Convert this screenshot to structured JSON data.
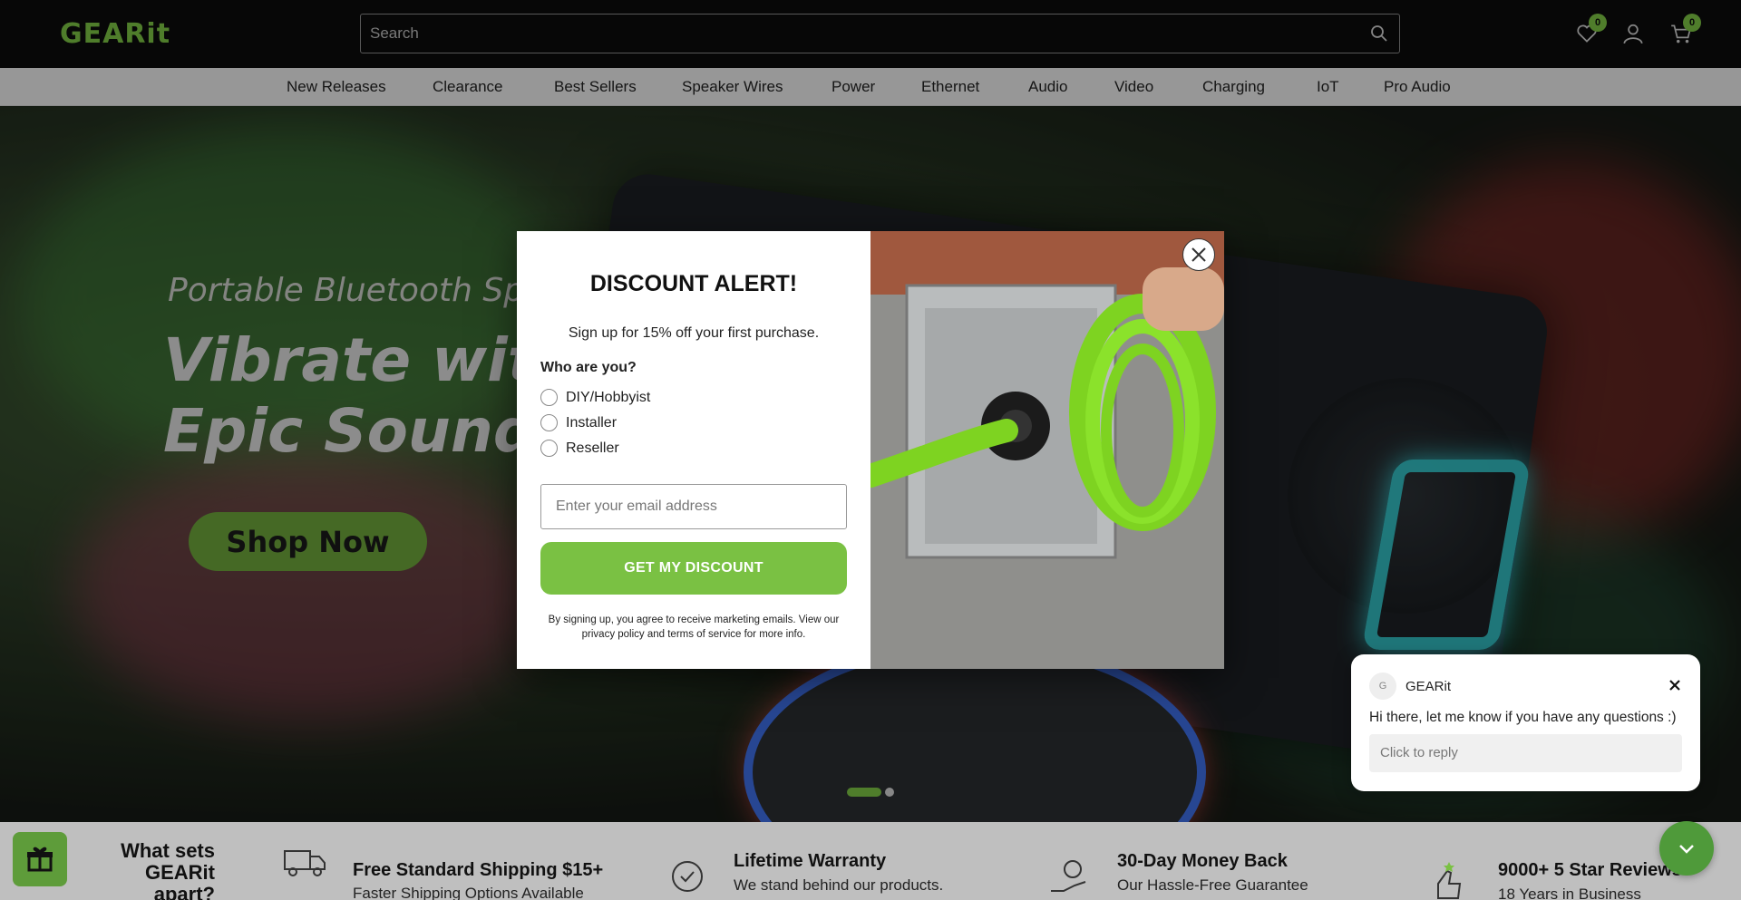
{
  "header": {
    "logo": "GEARit",
    "search_placeholder": "Search",
    "wishlist_count": "0",
    "cart_count": "0"
  },
  "nav": {
    "items": [
      "New Releases",
      "Clearance",
      "Best Sellers",
      "Speaker Wires",
      "Power",
      "Ethernet",
      "Audio",
      "Video",
      "Charging",
      "IoT",
      "Pro Audio"
    ]
  },
  "hero": {
    "subtitle": "Portable Bluetooth Spe",
    "title_line1": "Vibrate with",
    "title_line2": "Epic Sound",
    "cta": "Shop Now"
  },
  "features": {
    "apart_line1": "What sets GEARit",
    "apart_line2": "apart?",
    "items": [
      {
        "title": "Free Standard Shipping $15+",
        "text": "Faster Shipping Options Available"
      },
      {
        "title": "Lifetime Warranty",
        "text": "We stand behind our products."
      },
      {
        "title": "30-Day Money Back",
        "text": "Our Hassle-Free Guarantee"
      },
      {
        "title": "9000+ 5 Star Reviews",
        "text": "18 Years in Business"
      }
    ]
  },
  "modal": {
    "title": "DISCOUNT ALERT!",
    "subtitle": "Sign up for 15% off your first purchase.",
    "question": "Who are you?",
    "options": [
      "DIY/Hobbyist",
      "Installer",
      "Reseller"
    ],
    "email_placeholder": "Enter your email address",
    "button": "GET MY DISCOUNT",
    "legal": "By signing up, you agree to receive marketing emails. View our privacy policy and terms of service for more info."
  },
  "chat": {
    "avatar_letter": "G",
    "name": "GEARit",
    "message": "Hi there, let me know if you have any questions :)",
    "reply_placeholder": "Click to reply"
  },
  "colors": {
    "brand_green": "#7ac143",
    "header_bg": "#0b0b0b",
    "nav_bg": "#e9e9e9"
  }
}
